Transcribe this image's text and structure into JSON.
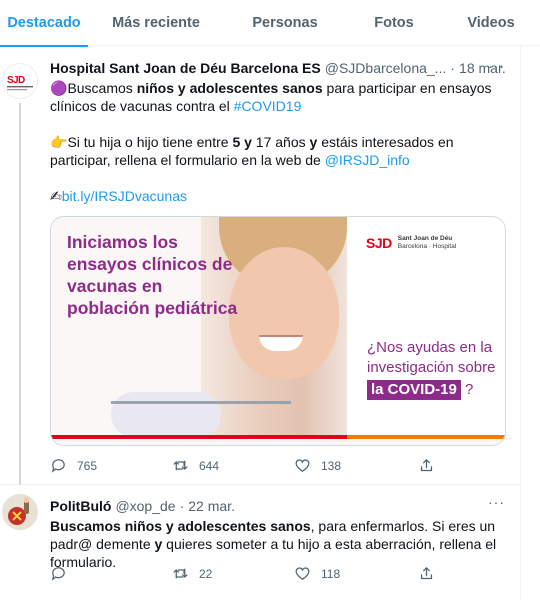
{
  "tabs": [
    "Destacado",
    "Más reciente",
    "Personas",
    "Fotos",
    "Videos"
  ],
  "tweets": [
    {
      "name": "Hospital Sant Joan de Déu Barcelona ES",
      "handle": "@SJDbarcelona_...",
      "dot": "·",
      "date": "18 mar.",
      "more": "···",
      "avatar_text": "SJD",
      "line1_pre": "Buscamos ",
      "line1_bold": "niños y adolescentes sanos",
      "line1_post": " para participar en ensayos clínicos de vacunas contra el ",
      "hashtag": "#COVID19",
      "line2_pre": "Si tu hija o hijo tiene entre ",
      "line2_b1": "5",
      "line2_b2": "y",
      "line2_mid": " 17 años ",
      "line2_b3": "y",
      "line2_post": " estáis interesados en participar, rellena el formulario en la web de ",
      "mention": "@IRSJD_info",
      "link": "bit.ly/IRSJDvacunas",
      "emoji_purple": "🟣",
      "emoji_point": "👉",
      "emoji_write": "✍",
      "image": {
        "headline": "Iniciamos los ensayos clínicos de vacunas en población pediátrica",
        "brand_mark": "SJD",
        "brand_name_1": "Sant Joan de Déu",
        "brand_name_2": "Barcelona · Hospital",
        "question": "¿Nos ayudas en la investigación sobre",
        "covid_tag": "la COVID-19",
        "question_end": "?"
      },
      "replies": "765",
      "retweets": "644",
      "likes": "138"
    },
    {
      "name": "PolitBuló",
      "handle": "@xop_de",
      "dot": "·",
      "date": "22 mar.",
      "more": "···",
      "bold": "Buscamos niños y adolescentes sanos",
      "post1": ", para enfermarlos. Si eres un padr@ demente ",
      "bold_y": "y",
      "post2": " quieres someter a tu hijo a esta aberración, rellena el formulario.",
      "replies": "",
      "retweets": "22",
      "likes": "118"
    }
  ],
  "colors": {
    "accent": "#1d9bf0",
    "brand_purple": "#8e2a8a",
    "brand_red": "#e2001a",
    "brand_orange": "#f07d00"
  }
}
